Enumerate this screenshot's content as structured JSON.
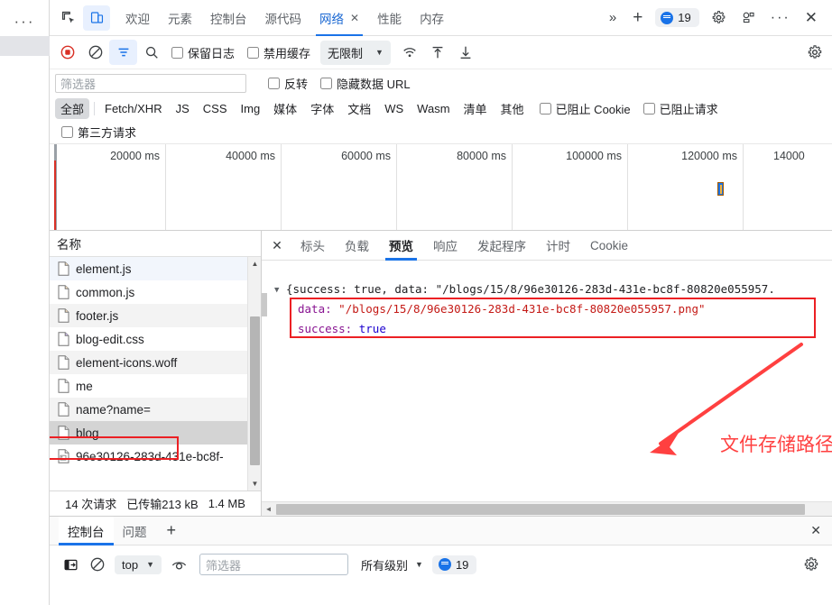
{
  "browser": {
    "menu_dots": "···"
  },
  "tabbar": {
    "inspect_icon": "inspect-element-icon",
    "device_icon": "device-toolbar-icon",
    "tabs": [
      {
        "label": "欢迎",
        "selected": false
      },
      {
        "label": "元素",
        "selected": false
      },
      {
        "label": "控制台",
        "selected": false
      },
      {
        "label": "源代码",
        "selected": false
      },
      {
        "label": "网络",
        "selected": true,
        "closable": true,
        "close_glyph": "✕"
      },
      {
        "label": "性能",
        "selected": false
      },
      {
        "label": "内存",
        "selected": false
      }
    ],
    "more_tabs_glyph": "»",
    "add_tab_glyph": "+",
    "message_count": "19",
    "settings_icon": "gear-icon",
    "customize_icon": "dock-settings-icon",
    "more_glyph": "···",
    "close_glyph": "✕"
  },
  "network_toolbar": {
    "record_icon": "record-stop-icon",
    "clear_icon": "clear-icon",
    "filter_icon": "filter-icon",
    "search_icon": "search-icon",
    "preserve_log": "保留日志",
    "disable_cache": "禁用缓存",
    "throttle_value": "无限制",
    "throttle_caret": "▼",
    "wifi_icon": "network-conditions-icon",
    "import_icon": "import-har-icon",
    "export_icon": "export-har-icon",
    "settings_icon": "gear-icon"
  },
  "filter_row": {
    "input_placeholder": "筛选器",
    "invert": "反转",
    "hide_data_urls": "隐藏数据 URL"
  },
  "type_filters": {
    "items": [
      "全部",
      "Fetch/XHR",
      "JS",
      "CSS",
      "Img",
      "媒体",
      "字体",
      "文档",
      "WS",
      "Wasm",
      "清单",
      "其他"
    ],
    "selected": "全部",
    "blocked_cookies": "已阻止 Cookie",
    "blocked_requests": "已阻止请求",
    "third_party": "第三方请求"
  },
  "overview": {
    "ticks": [
      "20000 ms",
      "40000 ms",
      "60000 ms",
      "80000 ms",
      "100000 ms",
      "120000 ms",
      "14000"
    ]
  },
  "request_list": {
    "header": "名称",
    "rows": [
      {
        "name": "element.js",
        "icon": "js-file-icon"
      },
      {
        "name": "common.js",
        "icon": "js-file-icon"
      },
      {
        "name": "footer.js",
        "icon": "js-file-icon"
      },
      {
        "name": "blog-edit.css",
        "icon": "css-file-icon"
      },
      {
        "name": "element-icons.woff",
        "icon": "font-file-icon"
      },
      {
        "name": "me",
        "icon": "doc-file-icon"
      },
      {
        "name": "name?name=",
        "icon": "doc-file-icon"
      },
      {
        "name": "blog",
        "icon": "doc-file-icon",
        "selected": true,
        "highlighted": true
      },
      {
        "name": "96e30126-283d-431e-bc8f- ",
        "icon": "image-file-icon"
      }
    ],
    "summary": [
      "14 次请求",
      "已传输213 kB",
      "1.4 MB"
    ]
  },
  "detail_panel": {
    "close_glyph": "✕",
    "tabs": [
      {
        "label": "标头",
        "selected": false
      },
      {
        "label": "负载",
        "selected": false
      },
      {
        "label": "预览",
        "selected": true
      },
      {
        "label": "响应",
        "selected": false
      },
      {
        "label": "发起程序",
        "selected": false
      },
      {
        "label": "计时",
        "selected": false
      },
      {
        "label": "Cookie",
        "selected": false
      }
    ],
    "preview": {
      "triangle": "▼",
      "root_line": "{success: true, data: \"/blogs/15/8/96e30126-283d-431e-bc8f-80820e055957.",
      "data_key": "data:",
      "data_value": "\"/blogs/15/8/96e30126-283d-431e-bc8f-80820e055957.png\"",
      "success_key": "success:",
      "success_value": "true"
    },
    "annotation": "文件存储路径",
    "annotation_color": "#ff4040"
  },
  "console_drawer": {
    "tabs": [
      {
        "label": "控制台",
        "selected": true
      },
      {
        "label": "问题",
        "selected": false
      }
    ],
    "add_glyph": "+",
    "close_glyph": "✕",
    "sidebar_icon": "console-sidebar-icon",
    "clear_icon": "clear-console-icon",
    "context": "top",
    "context_caret": "▼",
    "eye_icon": "live-expression-icon",
    "filter_placeholder": "筛选器",
    "level": "所有级别",
    "level_caret": "▼",
    "message_count": "19",
    "settings_icon": "gear-icon"
  },
  "colors": {
    "accent": "#1a73e8",
    "record_red": "#d93025",
    "annotation_red": "#ec2024"
  }
}
